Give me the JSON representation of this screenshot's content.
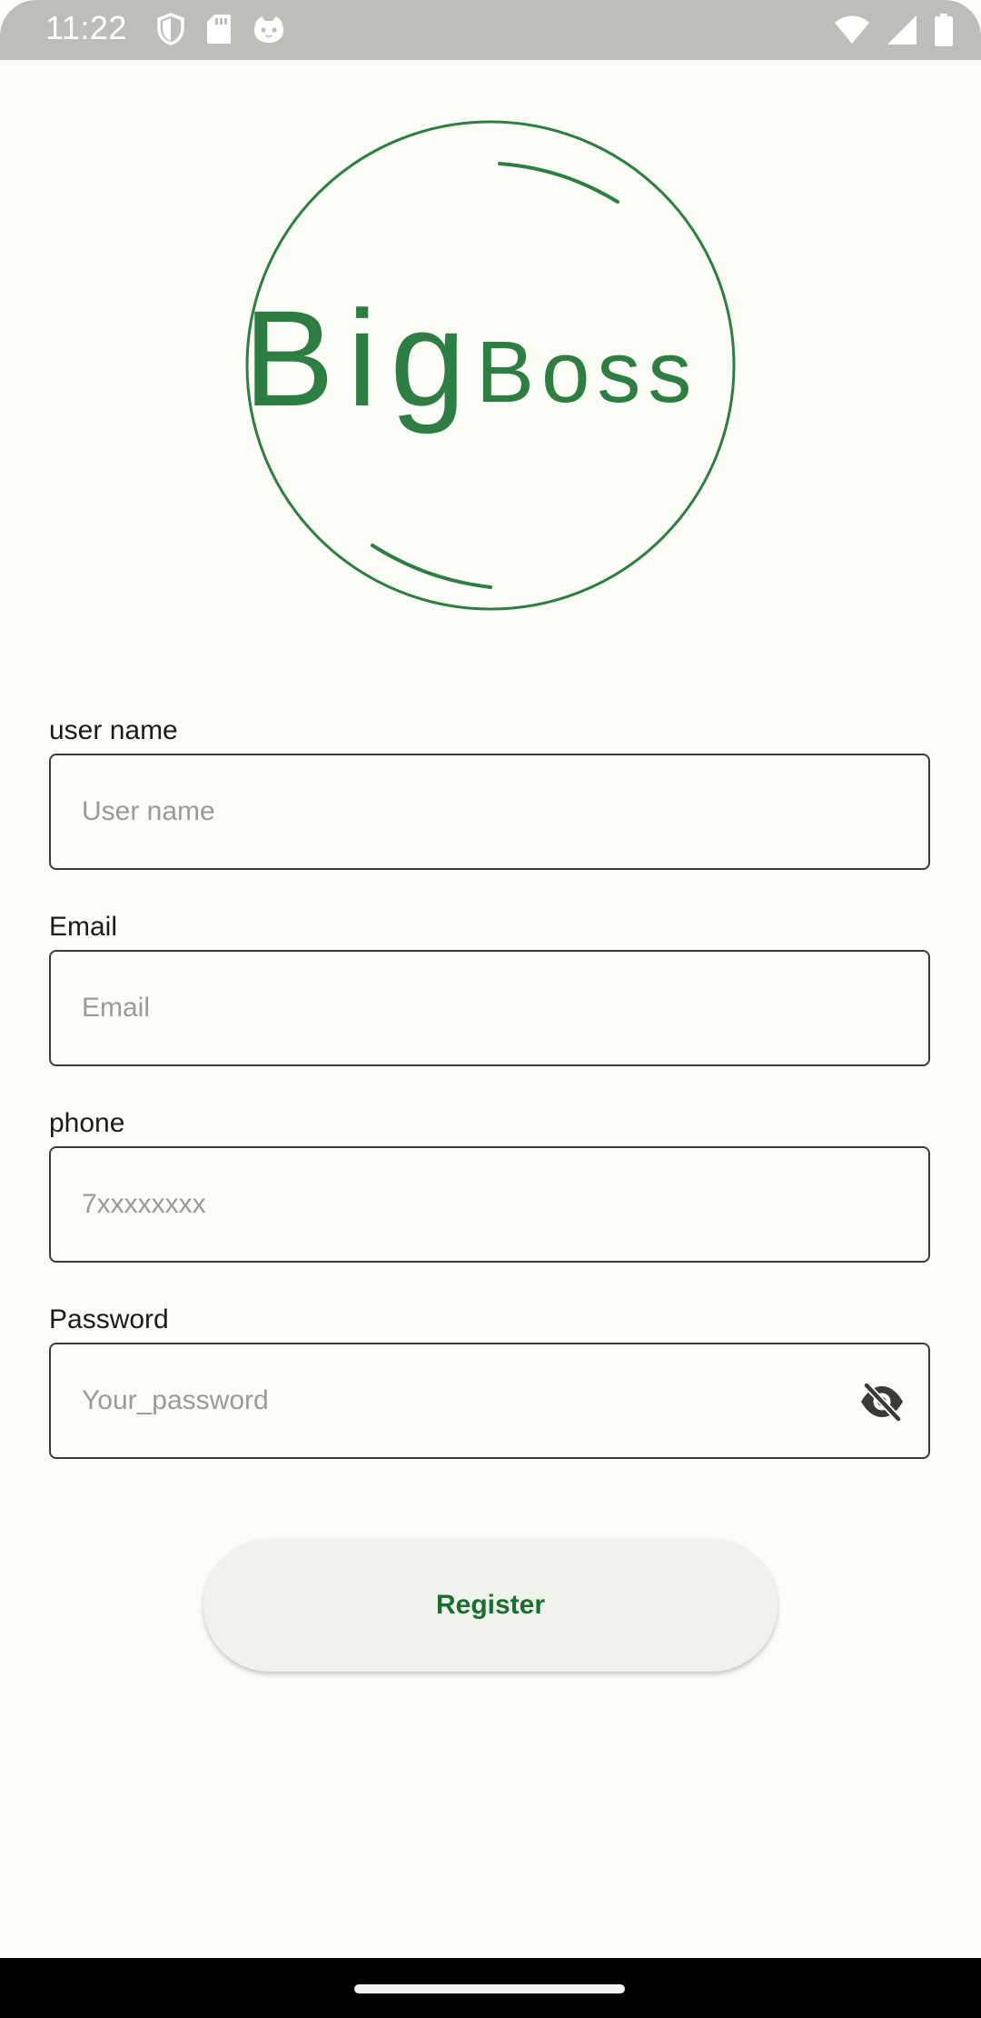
{
  "status_bar": {
    "time": "11:22",
    "left_icons": [
      "shield-icon",
      "sd-card-icon",
      "cat-face-icon"
    ],
    "right_icons": [
      "wifi-icon",
      "cellular-signal-icon",
      "battery-icon"
    ]
  },
  "logo": {
    "text_part1": "Big",
    "text_part2": "Boss",
    "color": "#2e7d43"
  },
  "form": {
    "username": {
      "label": "user name",
      "placeholder": "User name",
      "value": ""
    },
    "email": {
      "label": "Email",
      "placeholder": "Email",
      "value": ""
    },
    "phone": {
      "label": "phone",
      "placeholder": "7xxxxxxxx",
      "value": ""
    },
    "password": {
      "label": "Password",
      "placeholder": "Your_password",
      "value": "",
      "toggle_icon": "eye-off-icon"
    }
  },
  "register_button": {
    "label": "Register"
  },
  "colors": {
    "background": "#fcfdf6",
    "accent": "#1b6d32",
    "button_bg": "#eff3ec",
    "field_border": "#3a3b36",
    "placeholder": "#9a9b97"
  }
}
